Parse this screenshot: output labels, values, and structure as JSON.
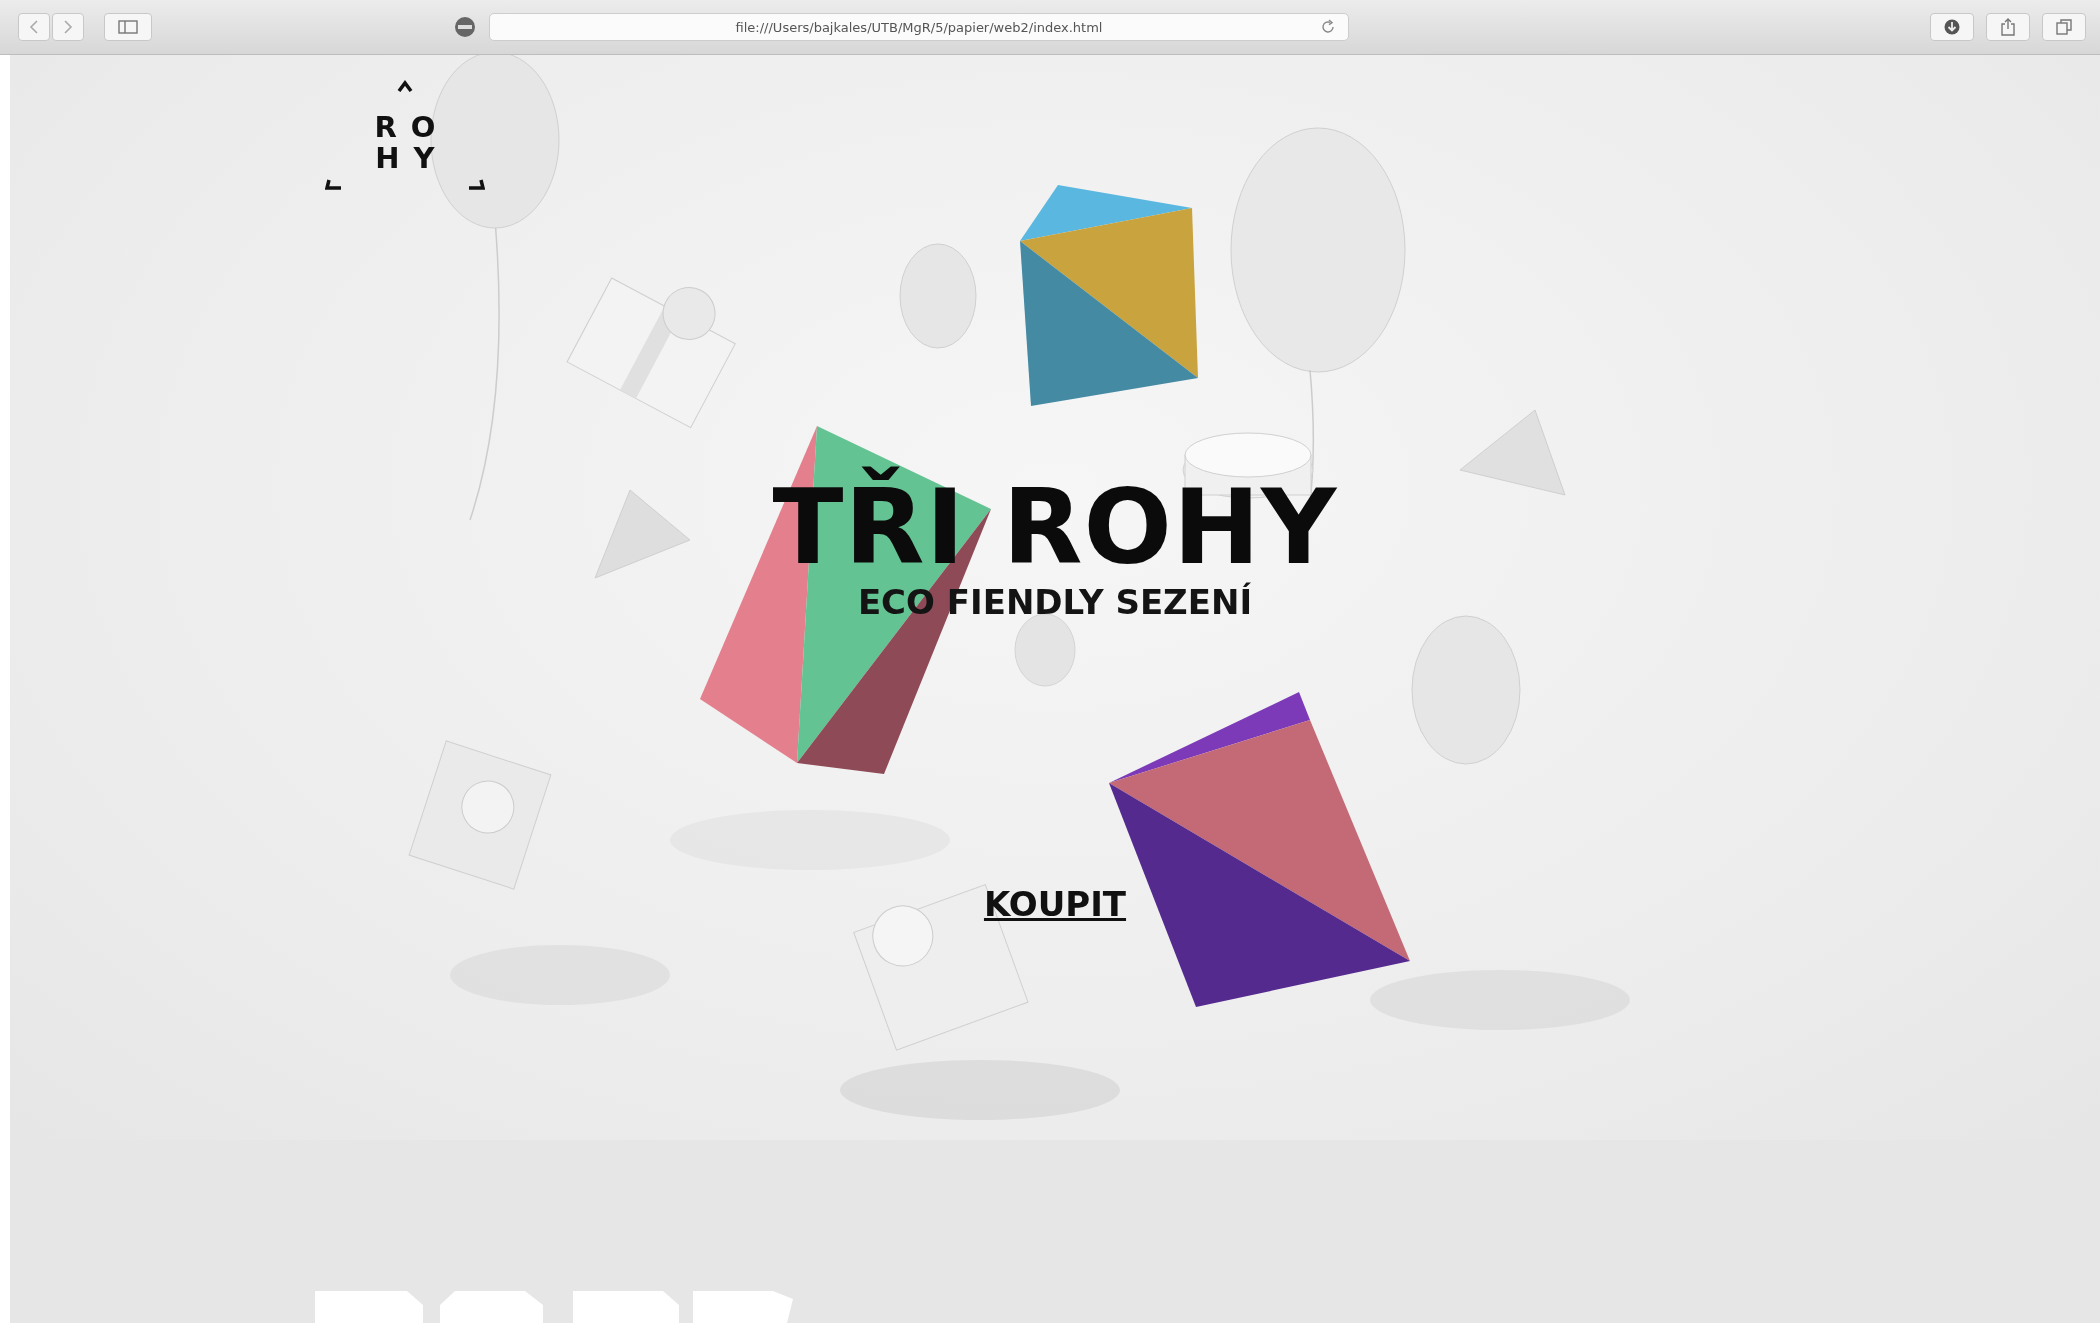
{
  "browser": {
    "url": "file:///Users/bajkales/UTB/MgR/5/papier/web2/index.html"
  },
  "logo": {
    "lines": [
      "RO",
      "HY"
    ]
  },
  "hero": {
    "title": "TŘI ROHY",
    "subtitle": "ECO FIENDLY SEZENÍ",
    "link": "KOUPIT"
  }
}
